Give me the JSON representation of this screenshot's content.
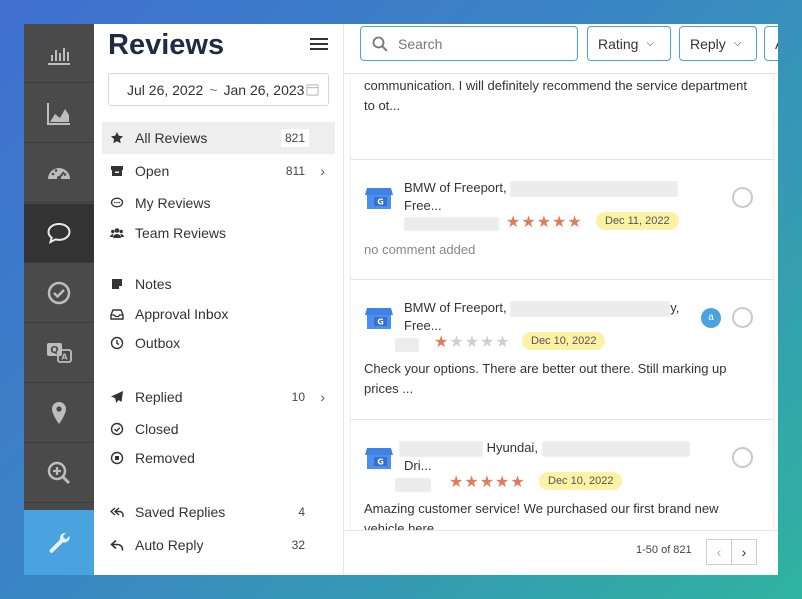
{
  "nav": {
    "title": "Reviews",
    "date_from": "Jul 26, 2022",
    "date_sep": "~",
    "date_to": "Jan 26, 2023",
    "items": [
      {
        "label": "All Reviews",
        "count": "821",
        "icon": "star-icon"
      },
      {
        "label": "Open",
        "count": "811",
        "icon": "inbox-icon",
        "chevron": "›"
      },
      {
        "label": "My Reviews",
        "count": "",
        "icon": "speech-bubble-icon"
      },
      {
        "label": "Team Reviews",
        "count": "",
        "icon": "users-icon"
      },
      {
        "label": "Notes",
        "count": "",
        "icon": "note-icon"
      },
      {
        "label": "Approval Inbox",
        "count": "",
        "icon": "tray-icon"
      },
      {
        "label": "Outbox",
        "count": "",
        "icon": "clock-icon"
      },
      {
        "label": "Replied",
        "count": "10",
        "icon": "paper-plane-icon",
        "chevron": "›"
      },
      {
        "label": "Closed",
        "count": "",
        "icon": "check-circle-icon"
      },
      {
        "label": "Removed",
        "count": "",
        "icon": "stop-circle-icon"
      },
      {
        "label": "Saved Replies",
        "count": "4",
        "icon": "reply-all-icon"
      },
      {
        "label": "Auto Reply",
        "count": "32",
        "icon": "reply-icon"
      }
    ]
  },
  "toolbar": {
    "search_placeholder": "Search",
    "rating_label": "Rating",
    "reply_label": "Reply",
    "more_label": "A"
  },
  "reviews": [
    {
      "text": "communication. I will definitely recommend the service department to ot..."
    },
    {
      "business": "BMW of Freeport,",
      "business_tail": "Free...",
      "stars": 5,
      "date": "Dec 11, 2022",
      "text": "no comment added"
    },
    {
      "business": "BMW of Freeport,",
      "business_tail_end": "y,",
      "business_tail": "Free...",
      "stars": 1,
      "date": "Dec 10, 2022",
      "badge": "a",
      "text": "Check your options. There are better out there. Still marking up prices ..."
    },
    {
      "business": "Hyundai,",
      "business_tail": "Dri...",
      "stars": 5,
      "date": "Dec 10, 2022",
      "text": "Amazing customer service! We purchased our first brand new vehicle here...."
    }
  ],
  "pagination": {
    "range": "1-50 of 821",
    "prev": "‹",
    "next": "›"
  },
  "colors": {
    "accent": "#4aa3df",
    "star": "#e27a5d",
    "date_pill": "#fbf2a6",
    "rail": "#4a4a4a"
  }
}
